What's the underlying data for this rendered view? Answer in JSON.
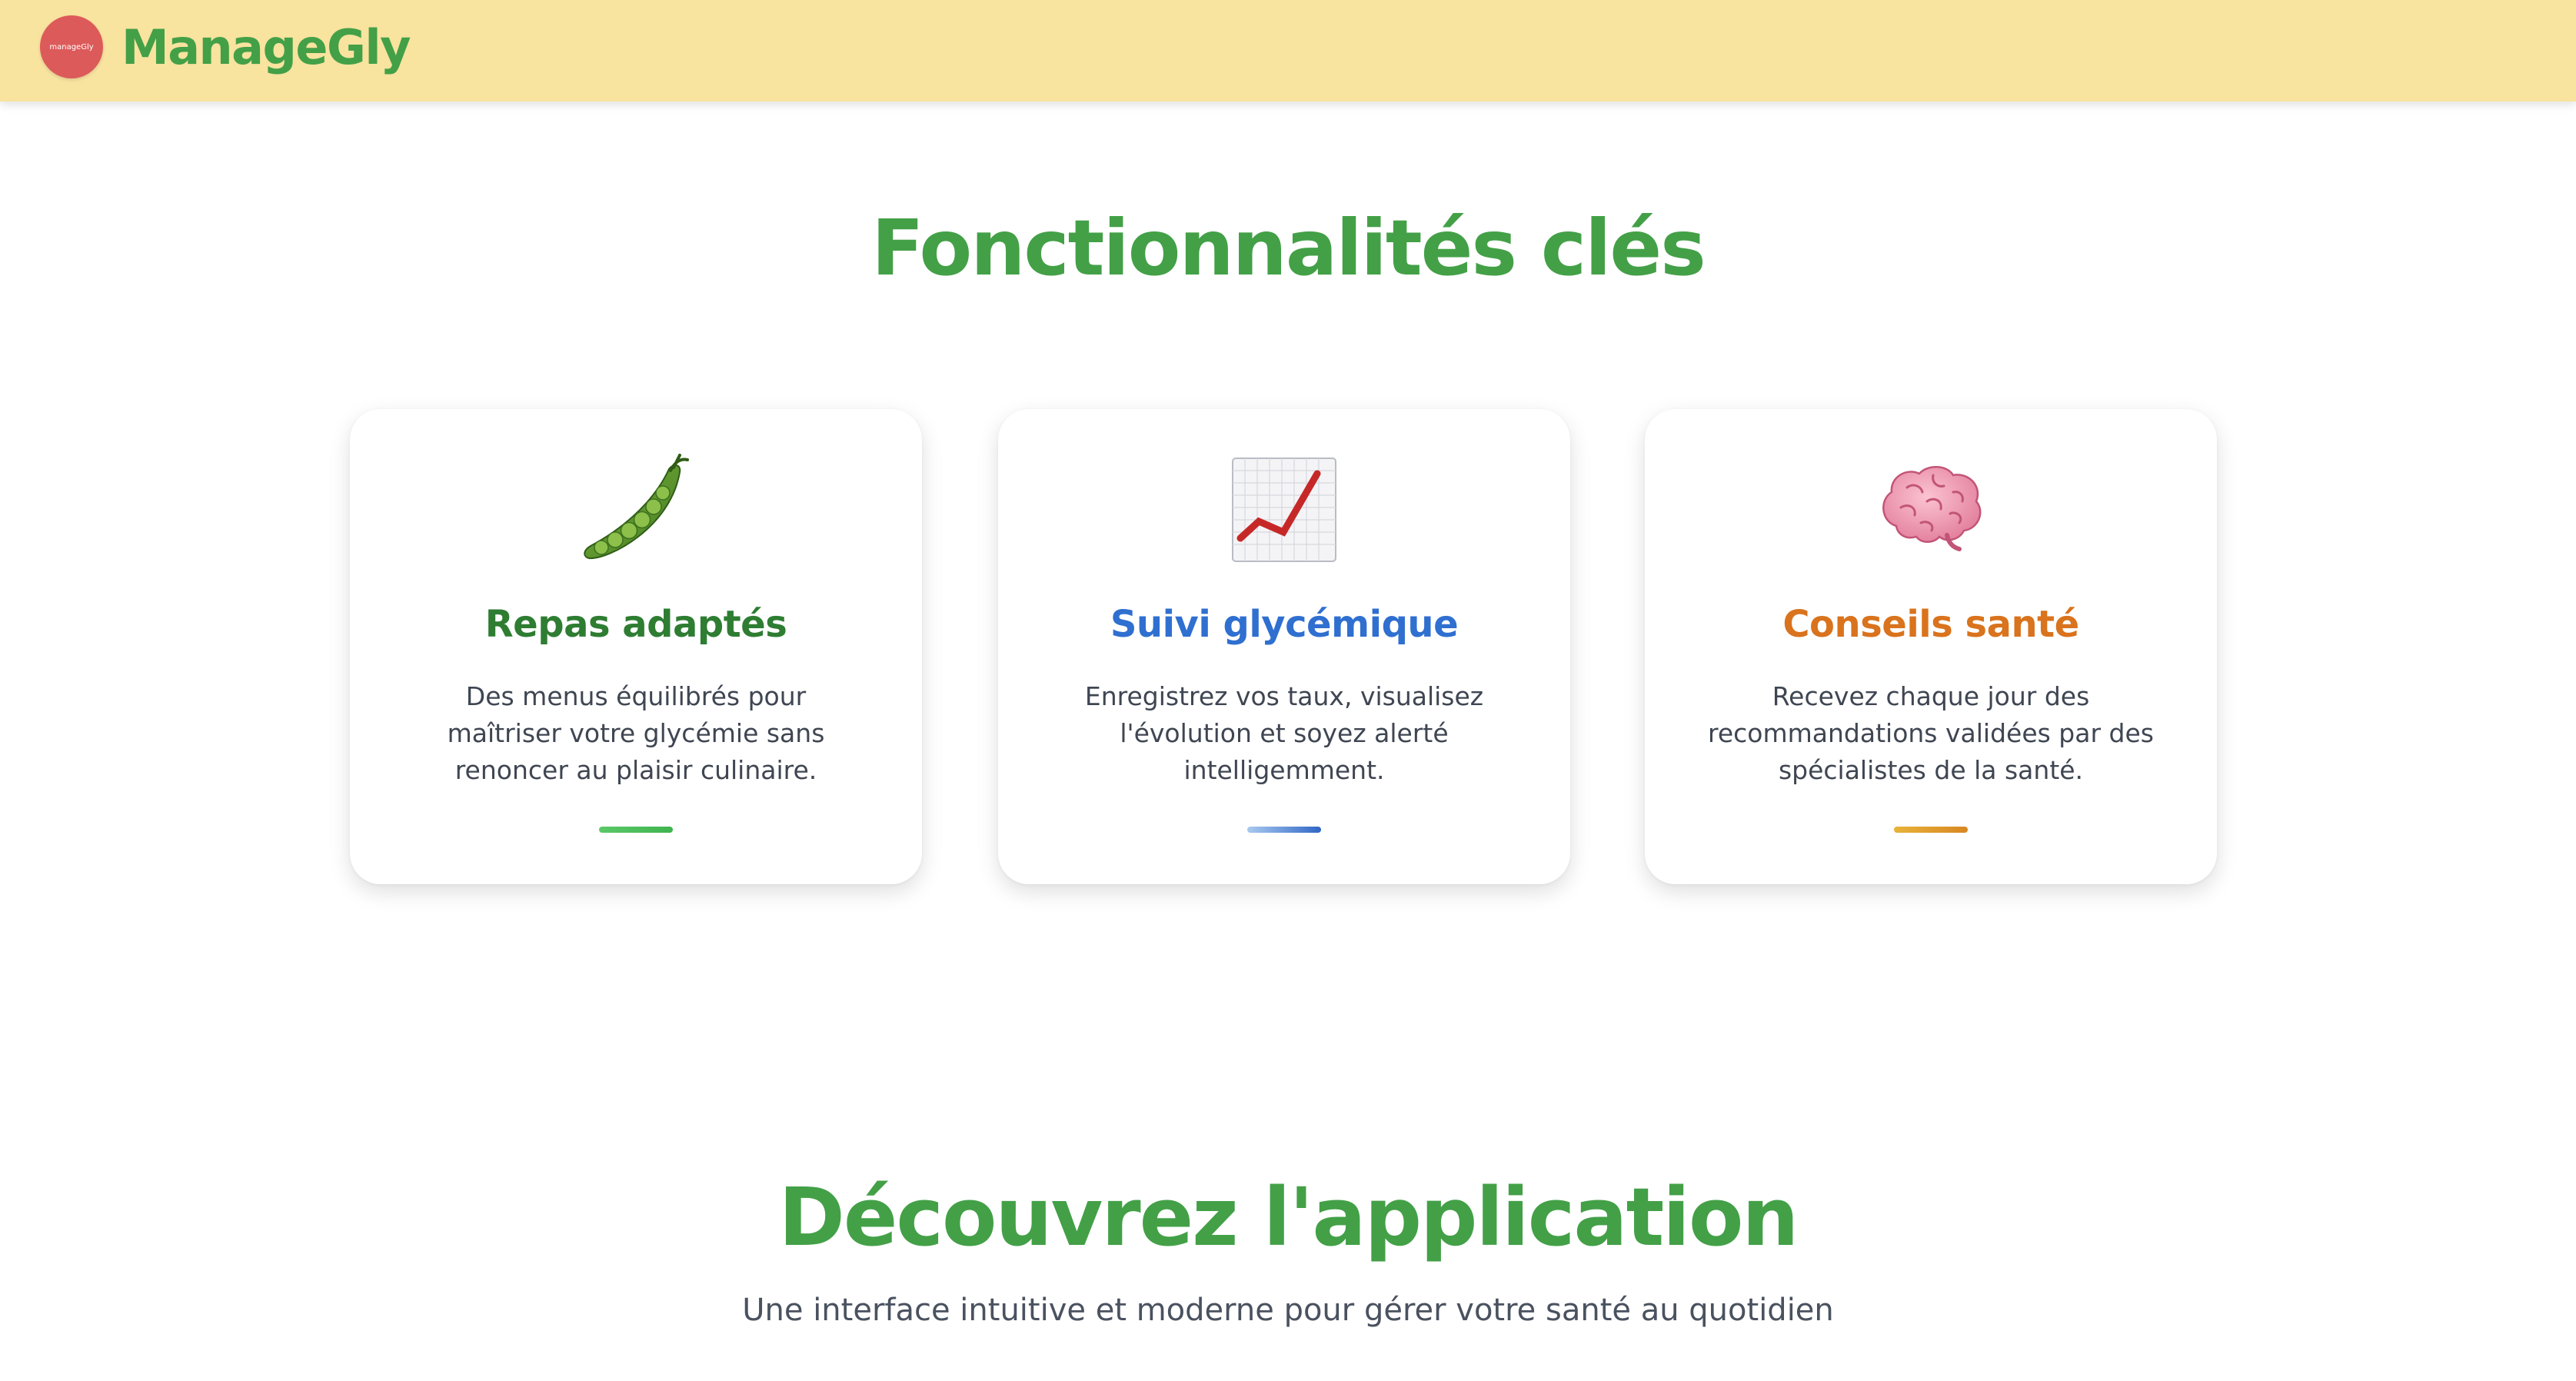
{
  "header": {
    "logo_text": "manageGly",
    "brand_name": "ManageGly"
  },
  "features": {
    "title": "Fonctionnalités clés",
    "cards": [
      {
        "icon": "pea-pod-icon",
        "title": "Repas adaptés",
        "text": "Des menus équilibrés pour maîtriser votre glycémie sans renoncer au plaisir culinaire.",
        "color": "#2e7d32"
      },
      {
        "icon": "chart-increasing-icon",
        "title": "Suivi glycémique",
        "text": "Enregistrez vos taux, visualisez l'évolution et soyez alerté intelligemment.",
        "color": "#2f6fd0"
      },
      {
        "icon": "brain-icon",
        "title": "Conseils santé",
        "text": "Recevez chaque jour des recommandations validées par des spécialistes de la santé.",
        "color": "#d9731d"
      }
    ]
  },
  "discover": {
    "title": "Découvrez l'application",
    "subtitle": "Une interface intuitive et moderne pour gérer votre santé au quotidien"
  },
  "colors": {
    "header_bg": "#f8e39f",
    "brand_green": "#43a047",
    "logo_red": "#dd5a5a"
  }
}
